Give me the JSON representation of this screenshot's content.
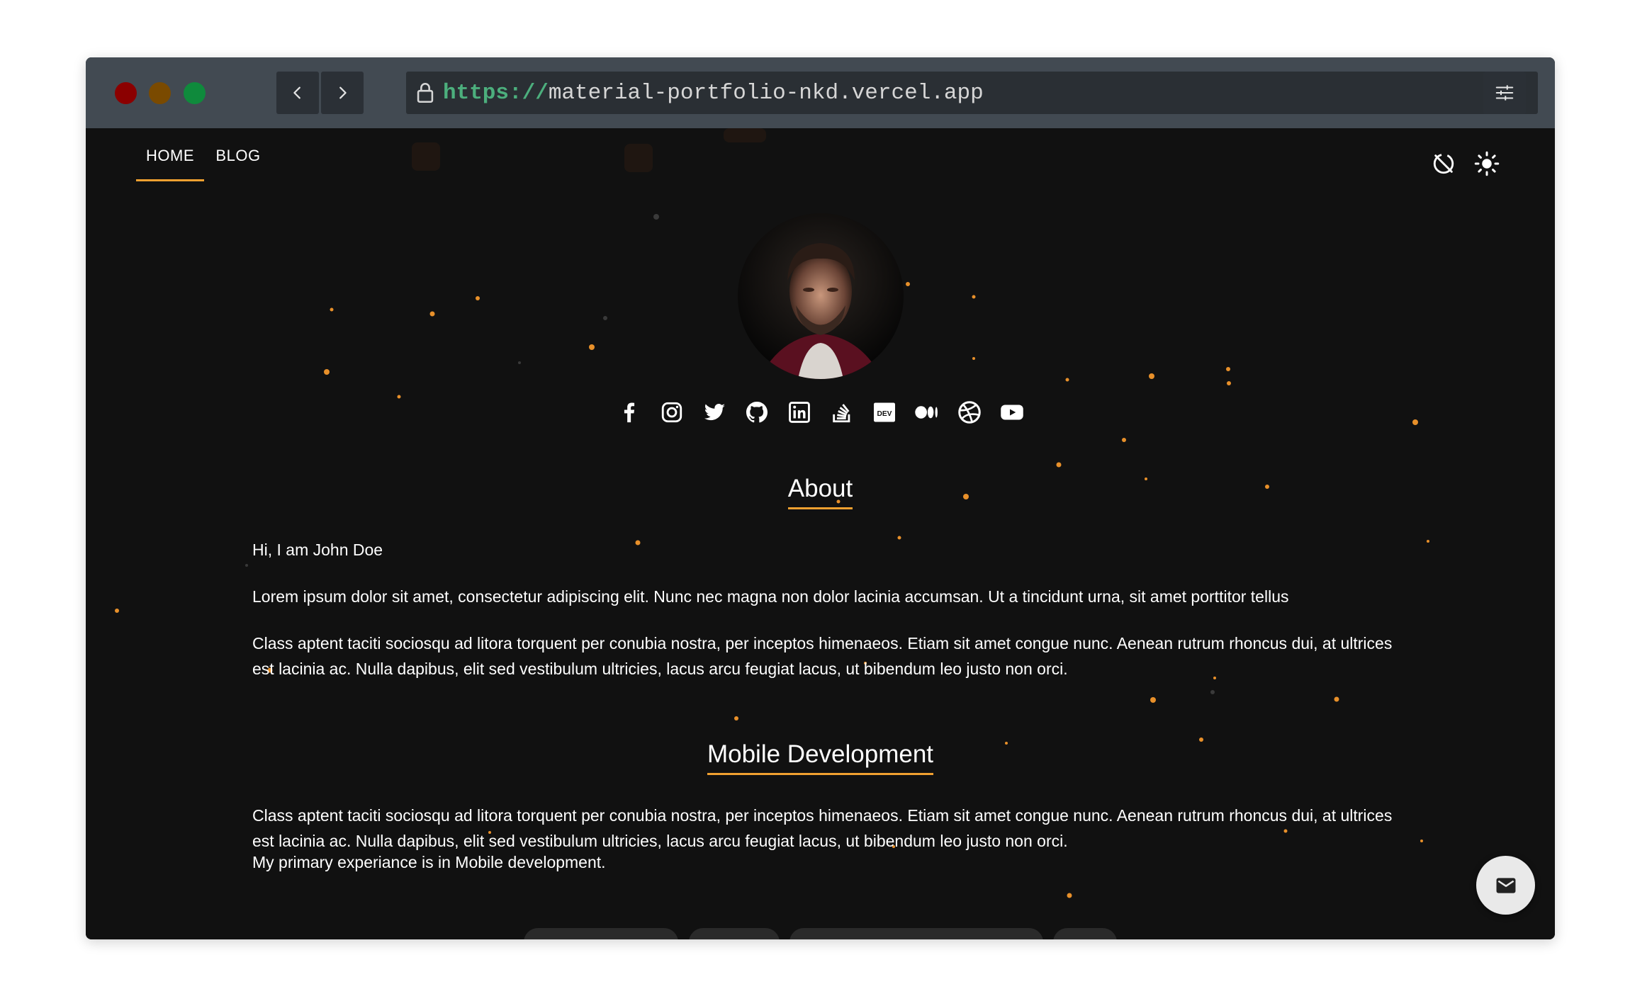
{
  "browser": {
    "url_scheme": "https://",
    "url_host": "material-portfolio-nkd.vercel.app",
    "traffic_lights": {
      "close": "#8b0000",
      "minimize": "#7a4a00",
      "maximize": "#0f8a3c"
    }
  },
  "nav": {
    "tabs": [
      {
        "label": "HOME",
        "active": true
      },
      {
        "label": "BLOG",
        "active": false
      }
    ],
    "accent_color": "#f0a030"
  },
  "profile": {
    "social_icons": [
      "facebook-icon",
      "instagram-icon",
      "twitter-icon",
      "github-icon",
      "linkedin-icon",
      "stackoverflow-icon",
      "dev-icon",
      "medium-icon",
      "dribbble-icon",
      "youtube-icon"
    ]
  },
  "about": {
    "heading": "About",
    "paragraphs": [
      "Hi, I am John Doe",
      "Lorem ipsum dolor sit amet, consectetur adipiscing elit. Nunc nec magna non dolor lacinia accumsan. Ut a tincidunt urna, sit amet porttitor tellus",
      "Class aptent taciti sociosqu ad litora torquent per conubia nostra, per inceptos himenaeos. Etiam sit amet congue nunc. Aenean rutrum rhoncus dui, at ultrices est lacinia ac. Nulla dapibus, elit sed vestibulum ultricies, lacus arcu feugiat lacus, ut bibendum leo justo non orci."
    ]
  },
  "mobile": {
    "heading": "Mobile Development",
    "paragraphs": [
      "Class aptent taciti sociosqu ad litora torquent per conubia nostra, per inceptos himenaeos. Etiam sit amet congue nunc. Aenean rutrum rhoncus dui, at ultrices est lacinia ac. Nulla dapibus, elit sed vestibulum ultricies, lacus arcu feugiat lacus, ut bibendum leo justo non orci.",
      "My primary experiance is in Mobile development."
    ]
  },
  "colors": {
    "background": "#111111",
    "accent": "#f0a030",
    "chrome": "#424a52"
  }
}
